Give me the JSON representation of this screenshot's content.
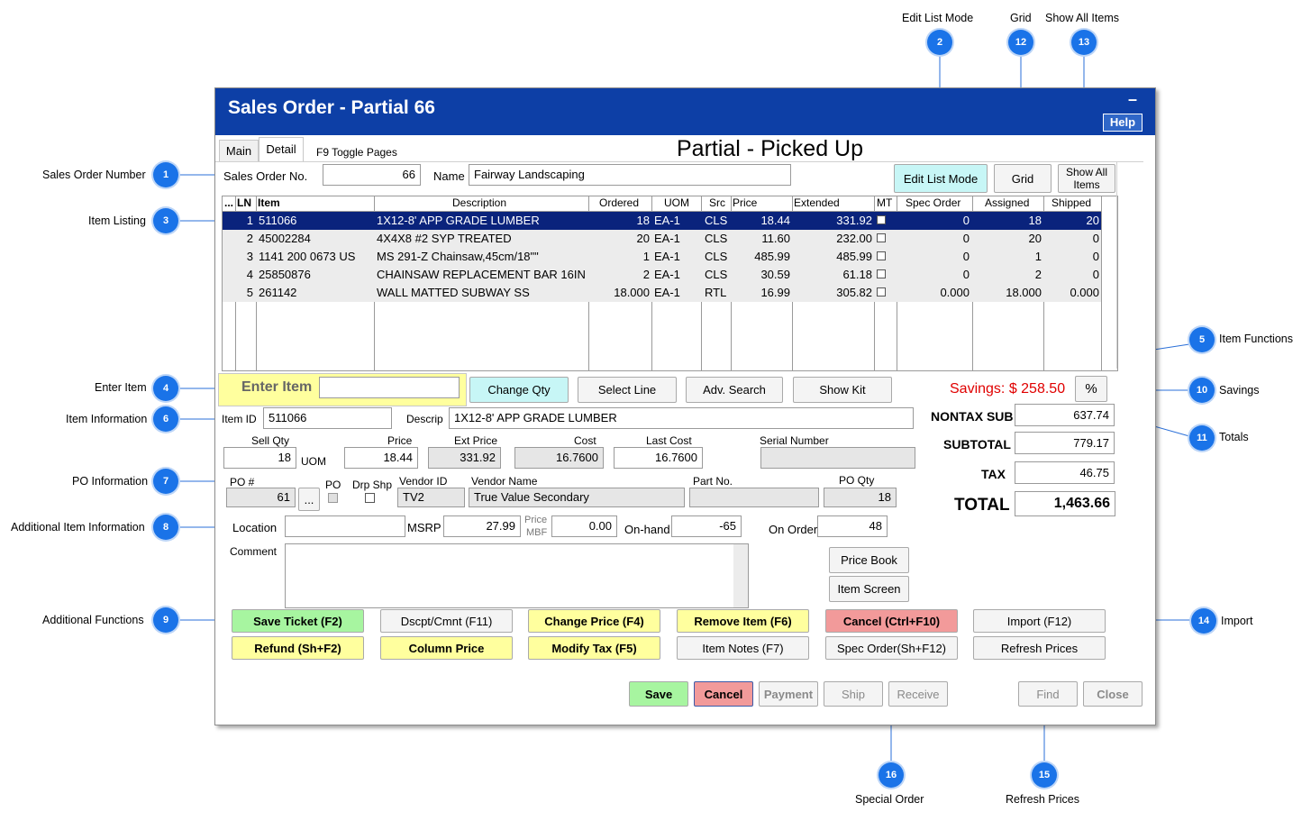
{
  "callouts": [
    {
      "num": "1",
      "label": "Sales Order Number"
    },
    {
      "num": "2",
      "label": "Edit List Mode"
    },
    {
      "num": "3",
      "label": "Item Listing"
    },
    {
      "num": "4",
      "label": "Enter Item"
    },
    {
      "num": "5",
      "label": "Item Functions"
    },
    {
      "num": "6",
      "label": "Item Information"
    },
    {
      "num": "7",
      "label": "PO Information"
    },
    {
      "num": "8",
      "label": "Additional Item Information"
    },
    {
      "num": "9",
      "label": "Additional Functions"
    },
    {
      "num": "10",
      "label": "Savings"
    },
    {
      "num": "11",
      "label": "Totals"
    },
    {
      "num": "12",
      "label": "Grid"
    },
    {
      "num": "13",
      "label": "Show All Items"
    },
    {
      "num": "14",
      "label": "Import"
    },
    {
      "num": "15",
      "label": "Refresh Prices"
    },
    {
      "num": "16",
      "label": "Special Order"
    }
  ],
  "window": {
    "title": "Sales Order - Partial 66",
    "help": "Help",
    "minimize": "–"
  },
  "tabs": {
    "main": "Main",
    "detail": "Detail",
    "toggle_hint": "F9 Toggle Pages"
  },
  "status": "Partial - Picked Up",
  "order": {
    "number_label": "Sales Order No.",
    "number": "66",
    "name_label": "Name",
    "name": "Fairway Landscaping"
  },
  "top_buttons": {
    "edit_list": "Edit List Mode",
    "grid": "Grid",
    "show_all": "Show All Items"
  },
  "grid": {
    "headers": [
      "...",
      "LN",
      "Item",
      "Description",
      "Ordered",
      "UOM",
      "Src",
      "Price",
      "Extended",
      "MT",
      "Spec Order",
      "Assigned",
      "Shipped"
    ],
    "rows": [
      {
        "ln": "1",
        "item": "511066",
        "desc": "1X12-8' APP GRADE LUMBER",
        "ordered": "18",
        "uom": "EA-1",
        "src": "CLS",
        "price": "18.44",
        "ext": "331.92",
        "spec": "0",
        "assigned": "18",
        "shipped": "20"
      },
      {
        "ln": "2",
        "item": "45002284",
        "desc": "4X4X8 #2 SYP TREATED",
        "ordered": "20",
        "uom": "EA-1",
        "src": "CLS",
        "price": "11.60",
        "ext": "232.00",
        "spec": "0",
        "assigned": "20",
        "shipped": "0"
      },
      {
        "ln": "3",
        "item": "1141 200 0673 US",
        "desc": "MS 291-Z Chainsaw,45cm/18\"\"",
        "ordered": "1",
        "uom": "EA-1",
        "src": "CLS",
        "price": "485.99",
        "ext": "485.99",
        "spec": "0",
        "assigned": "1",
        "shipped": "0"
      },
      {
        "ln": "4",
        "item": "25850876",
        "desc": "CHAINSAW REPLACEMENT BAR 16IN",
        "ordered": "2",
        "uom": "EA-1",
        "src": "CLS",
        "price": "30.59",
        "ext": "61.18",
        "spec": "0",
        "assigned": "2",
        "shipped": "0"
      },
      {
        "ln": "5",
        "item": "261142",
        "desc": "WALL MATTED SUBWAY SS",
        "ordered": "18.000",
        "uom": "EA-1",
        "src": "RTL",
        "price": "16.99",
        "ext": "305.82",
        "spec": "0.000",
        "assigned": "18.000",
        "shipped": "0.000"
      }
    ]
  },
  "enter_item": {
    "label": "Enter Item",
    "value": ""
  },
  "item_functions": {
    "change_qty": "Change Qty",
    "select_line": "Select Line",
    "adv_search": "Adv. Search",
    "show_kit": "Show Kit"
  },
  "savings": {
    "text": "Savings: $ 258.50",
    "pct": "%"
  },
  "item_info": {
    "id_label": "Item ID",
    "id": "511066",
    "descrip_label": "Descrip",
    "descrip": "1X12-8' APP GRADE LUMBER",
    "sell_qty_label": "Sell Qty",
    "sell_qty": "18",
    "uom_label": "UOM",
    "price_label": "Price",
    "price": "18.44",
    "ext_price_label": "Ext Price",
    "ext_price": "331.92",
    "cost_label": "Cost",
    "cost": "16.7600",
    "last_cost_label": "Last Cost",
    "last_cost": "16.7600",
    "serial_label": "Serial Number",
    "serial": ""
  },
  "po": {
    "po_num_label": "PO #",
    "po_num": "61",
    "dots": "...",
    "po_label": "PO",
    "drp_label": "Drp Shp",
    "vendor_id_label": "Vendor ID",
    "vendor_id": "TV2",
    "vendor_name_label": "Vendor Name",
    "vendor_name": "True Value Secondary",
    "part_label": "Part No.",
    "part": "",
    "po_qty_label": "PO Qty",
    "po_qty": "18"
  },
  "addl": {
    "location_label": "Location",
    "location": "",
    "msrp_label": "MSRP",
    "msrp": "27.99",
    "price_mbf_label1": "Price",
    "price_mbf_label2": "MBF",
    "price_mbf": "0.00",
    "onhand_label": "On-hand",
    "onhand": "-65",
    "onorder_label": "On Order",
    "onorder": "48",
    "comment_label": "Comment",
    "comment": ""
  },
  "side_buttons": {
    "price_book": "Price Book",
    "item_screen": "Item Screen"
  },
  "totals": {
    "nontax_label": "NONTAX SUB",
    "nontax": "637.74",
    "subtotal_label": "SUBTOTAL",
    "subtotal": "779.17",
    "tax_label": "TAX",
    "tax": "46.75",
    "total_label": "TOTAL",
    "total": "1,463.66"
  },
  "functions": {
    "save_ticket": "Save Ticket (F2)",
    "dscpt": "Dscpt/Cmnt (F11)",
    "change_price": "Change Price (F4)",
    "remove_item": "Remove Item (F6)",
    "cancel_ticket": "Cancel (Ctrl+F10)",
    "import": "Import (F12)",
    "refund": "Refund (Sh+F2)",
    "column_price": "Column Price",
    "modify_tax": "Modify Tax (F5)",
    "item_notes": "Item Notes (F7)",
    "spec_order": "Spec Order(Sh+F12)",
    "refresh": "Refresh Prices"
  },
  "bottom_buttons": {
    "save": "Save",
    "cancel": "Cancel",
    "payment": "Payment",
    "ship": "Ship",
    "receive": "Receive",
    "find": "Find",
    "close": "Close"
  },
  "colors": {
    "title_bar": "#0d3fa6",
    "callout": "#1a73e8",
    "savings": "#e00000",
    "selected_row": "#0a237c"
  }
}
